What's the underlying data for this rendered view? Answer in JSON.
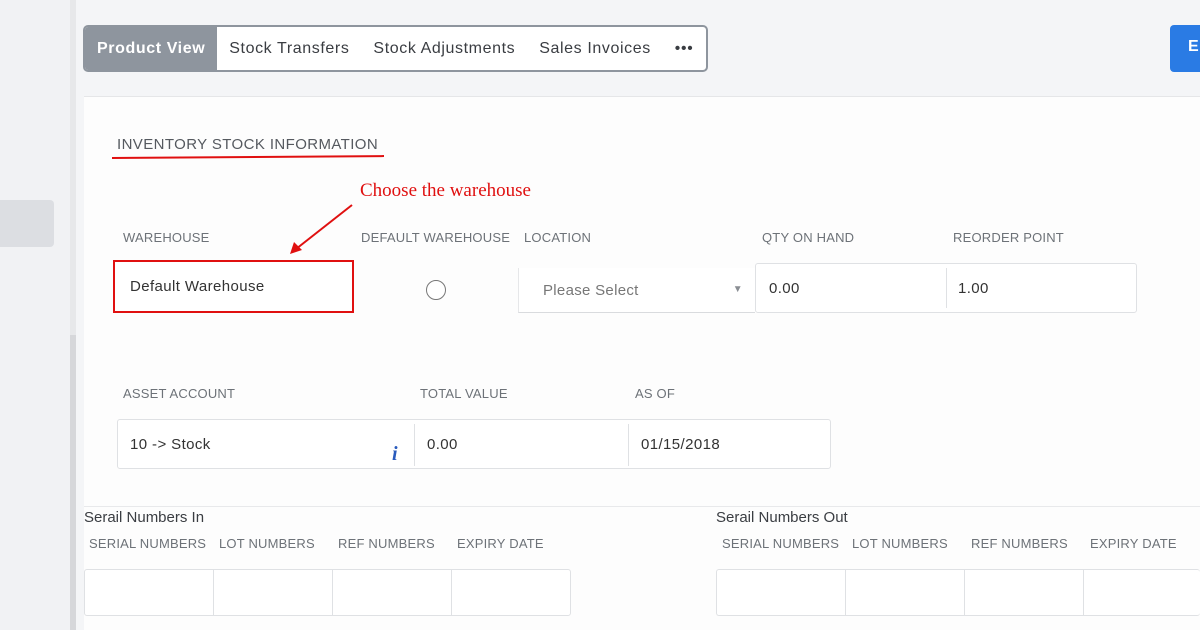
{
  "tabs": [
    {
      "label": "Product View",
      "active": true
    },
    {
      "label": "Stock Transfers",
      "active": false
    },
    {
      "label": "Stock Adjustments",
      "active": false
    },
    {
      "label": "Sales Invoices",
      "active": false
    },
    {
      "label": "•••",
      "active": false
    }
  ],
  "header_button": {
    "label": "E"
  },
  "section": {
    "title": "INVENTORY STOCK INFORMATION"
  },
  "annotation": {
    "text": "Choose the warehouse"
  },
  "warehouse_row": {
    "labels": {
      "warehouse": "WAREHOUSE",
      "default_warehouse": "DEFAULT WAREHOUSE",
      "location": "LOCATION",
      "qty_on_hand": "QTY ON HAND",
      "reorder_point": "REORDER POINT"
    },
    "warehouse": "Default Warehouse",
    "location_placeholder": "Please Select",
    "qty_on_hand": "0.00",
    "reorder_point": "1.00"
  },
  "asset_row": {
    "labels": {
      "asset_account": "ASSET ACCOUNT",
      "total_value": "TOTAL VALUE",
      "as_of": "AS OF"
    },
    "asset_account": "10 -> Stock",
    "total_value": "0.00",
    "as_of": "01/15/2018"
  },
  "serial_in": {
    "title": "Serail Numbers In",
    "columns": [
      "SERIAL NUMBERS",
      "LOT NUMBERS",
      "REF NUMBERS",
      "EXPIRY DATE"
    ]
  },
  "serial_out": {
    "title": "Serail Numbers Out",
    "columns": [
      "SERIAL NUMBERS",
      "LOT NUMBERS",
      "REF NUMBERS",
      "EXPIRY DATE"
    ]
  },
  "colors": {
    "active_tab": "#8e959e",
    "primary_button": "#2a7be4",
    "annotation_red": "#e01010"
  }
}
